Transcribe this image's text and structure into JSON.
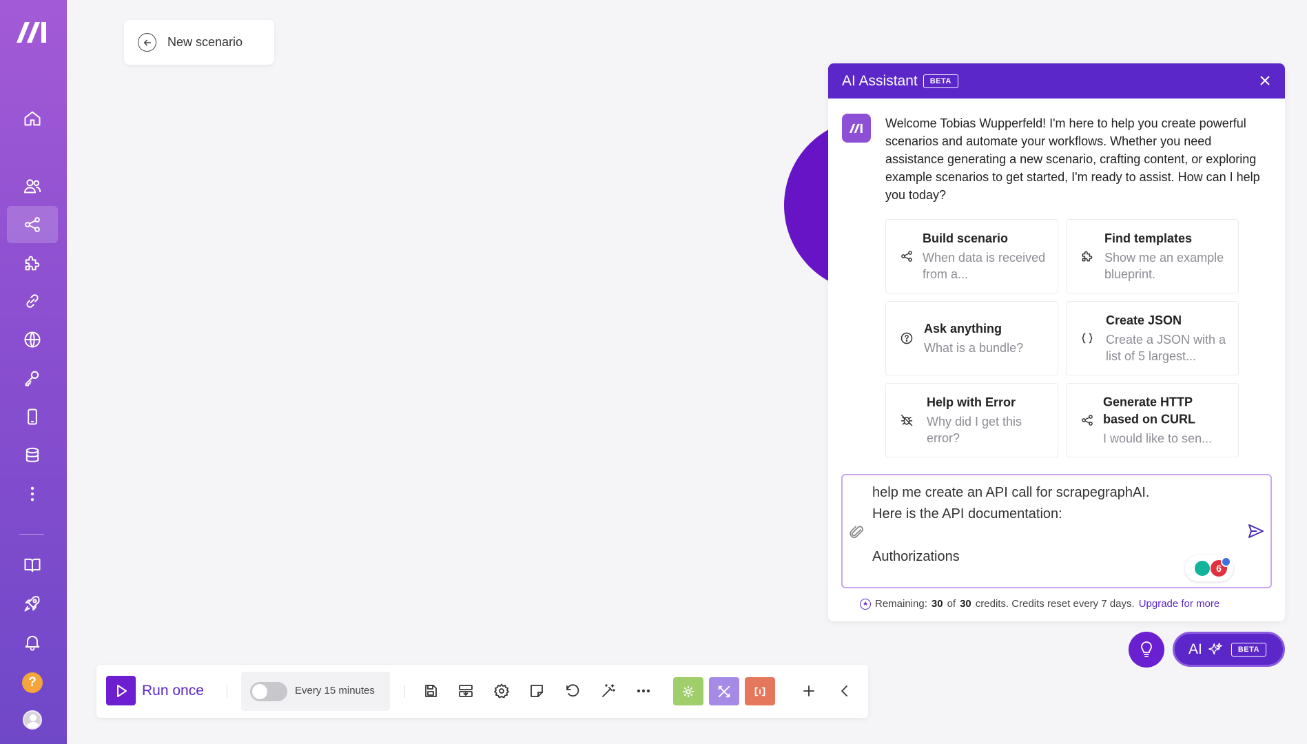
{
  "header": {
    "scenario_title": "New scenario"
  },
  "sidebar": {
    "items": [
      {
        "name": "home-icon"
      },
      {
        "name": "team-icon"
      },
      {
        "name": "scenarios-icon",
        "active": true
      },
      {
        "name": "apps-icon"
      },
      {
        "name": "connections-icon"
      },
      {
        "name": "webhooks-icon"
      },
      {
        "name": "keys-icon"
      },
      {
        "name": "devices-icon"
      },
      {
        "name": "datastores-icon"
      },
      {
        "name": "more-icon"
      },
      {
        "name": "docs-icon"
      },
      {
        "name": "rocket-icon"
      },
      {
        "name": "notifications-icon"
      }
    ],
    "help_label": "?"
  },
  "ai_panel": {
    "title": "AI Assistant",
    "beta": "BETA",
    "welcome": "Welcome Tobias Wupperfeld! I'm here to help you create powerful scenarios and automate your workflows. Whether you need assistance generating a new scenario, crafting content, or exploring example scenarios to get started, I'm ready to assist. How can I help you today?",
    "suggestions": [
      {
        "title": "Build scenario",
        "subtitle": "When data is received from a...",
        "icon": "share-icon"
      },
      {
        "title": "Find templates",
        "subtitle": "Show me an example blueprint.",
        "icon": "puzzle-icon"
      },
      {
        "title": "Ask anything",
        "subtitle": "What is a bundle?",
        "icon": "question-icon"
      },
      {
        "title": "Create JSON",
        "subtitle": "Create a JSON with a list of 5 largest...",
        "icon": "braces-icon"
      },
      {
        "title": "Help with Error",
        "subtitle": "Why did I get this error?",
        "icon": "bug-icon"
      },
      {
        "title": "Generate HTTP based on CURL",
        "subtitle": "I would like to sen...",
        "icon": "share-icon"
      }
    ],
    "input_value": "help me create an API call for scrapegraphAI.\nHere is the API documentation:\n\nAuthorizations",
    "grammar_count": "6",
    "credits": {
      "prefix": "Remaining:",
      "remaining": "30",
      "of": "of",
      "total": "30",
      "suffix": "credits. Credits reset every 7 days.",
      "upgrade": "Upgrade for more"
    }
  },
  "floating": {
    "ai_label": "AI",
    "beta": "BETA"
  },
  "toolbar": {
    "run_label": "Run once",
    "schedule_label": "Every 15 minutes",
    "schedule_enabled": false
  },
  "colors": {
    "accent": "#5b27c9",
    "tool_green": "#9fce6a",
    "tool_violet": "#a58be6",
    "tool_orange": "#e5775c"
  }
}
